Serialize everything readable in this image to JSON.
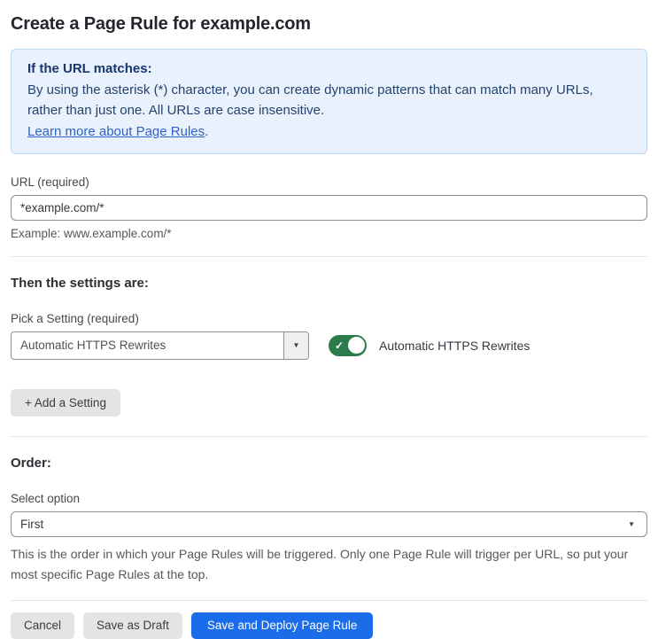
{
  "page": {
    "title": "Create a Page Rule for example.com"
  },
  "info_box": {
    "heading": "If the URL matches:",
    "body": "By using the asterisk (*) character, you can create dynamic patterns that can match many URLs, rather than just one. All URLs are case insensitive.",
    "link_label": "Learn more about Page Rules",
    "link_suffix": "."
  },
  "url_field": {
    "label": "URL (required)",
    "value": "*example.com/*",
    "helper": "Example: www.example.com/*"
  },
  "settings_section": {
    "heading": "Then the settings are:",
    "picker_label": "Pick a Setting (required)",
    "selected_setting": "Automatic HTTPS Rewrites",
    "toggle_state": "on",
    "toggle_label": "Automatic HTTPS Rewrites",
    "add_button_label": "+ Add a Setting"
  },
  "order_section": {
    "heading": "Order:",
    "select_label": "Select option",
    "selected_option": "First",
    "helper": "This is the order in which your Page Rules will be triggered. Only one Page Rule will trigger per URL, so put your most specific Page Rules at the top."
  },
  "footer": {
    "cancel_label": "Cancel",
    "save_draft_label": "Save as Draft",
    "save_deploy_label": "Save and Deploy Page Rule"
  },
  "icons": {
    "dropdown_arrow": "▼",
    "checkmark": "✓"
  },
  "colors": {
    "info_bg": "#e9f2fc",
    "info_border": "#bdd8f2",
    "info_text": "#24426f",
    "link_blue": "#2c62c9",
    "toggle_green": "#2c7b4b",
    "primary_blue": "#1a6ce8",
    "button_gray": "#e4e4e4"
  }
}
